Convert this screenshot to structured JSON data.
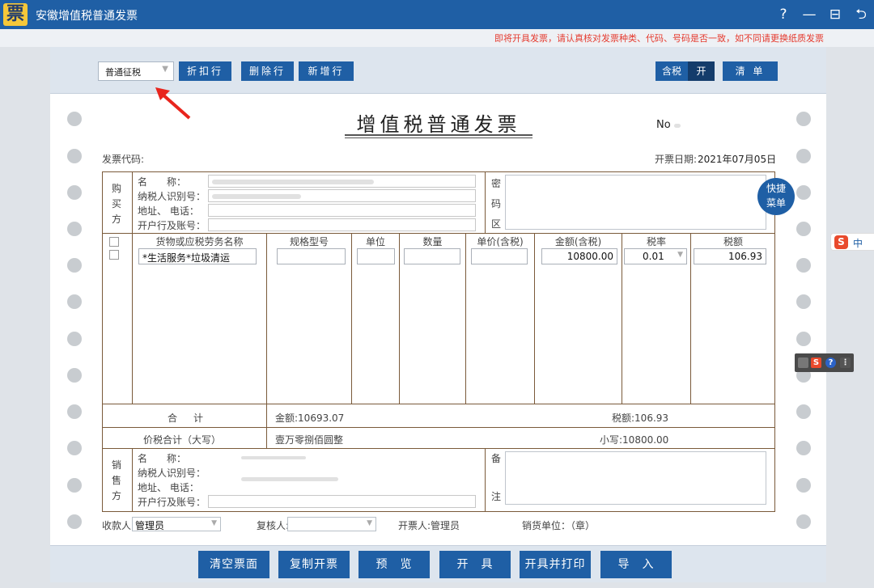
{
  "window": {
    "title": "安徽增值税普通发票",
    "logo_text": "票",
    "controls": [
      "?",
      "—",
      "⊟",
      "⮌"
    ]
  },
  "notice": "即将开具发票，请认真核对发票种类、代码、号码是否一致，如不同请更换纸质发票",
  "toolbar": {
    "tax_mode": "普通征税",
    "discount_btn": "折扣行",
    "delete_btn": "删除行",
    "add_btn": "新增行",
    "tax_incl_label": "含税",
    "tax_incl_state": "开",
    "list_btn": "清 单"
  },
  "invoice": {
    "title": "增值税普通发票",
    "no_label": "No",
    "code_label": "发票代码:",
    "date_label": "开票日期:",
    "date_value": "2021年07月05日",
    "buyer": {
      "side_label": [
        "购",
        "买",
        "方"
      ],
      "name_label": "名　　称：",
      "taxid_label": "纳税人识别号：",
      "addr_label": "地址、 电话：",
      "bank_label": "开户行及账号："
    },
    "cipher_label": [
      "密",
      "码",
      "区"
    ],
    "columns": [
      "货物或应税劳务名称",
      "规格型号",
      "单位",
      "数量",
      "单价(含税)",
      "金额(含税)",
      "税率",
      "税额"
    ],
    "rows": [
      {
        "name": "*生活服务*垃圾清运",
        "spec": "",
        "unit": "",
        "qty": "",
        "price": "",
        "amount": "10800.00",
        "rate": "0.01",
        "tax": "106.93"
      }
    ],
    "total_label": "合　计",
    "total_amount": "金额:10693.07",
    "total_tax": "税额:106.93",
    "grand_label": "价税合计（大写）",
    "grand_upper": "壹万零捌佰圆整",
    "grand_lower": "小写:10800.00",
    "seller": {
      "side_label": [
        "销",
        "售",
        "方"
      ],
      "name_label": "名　　称：",
      "taxid_label": "纳税人识别号：",
      "addr_label": "地址、 电话：",
      "bank_label": "开户行及账号："
    },
    "remark_label": [
      "备",
      "注"
    ],
    "payee_label": "收款人:",
    "payee_value": "管理员",
    "reviewer_label": "复核人:",
    "drawer": "开票人:管理员",
    "seller_seal": "销货单位：（章）"
  },
  "quick_menu": [
    "快捷",
    "菜单"
  ],
  "bottom_buttons": [
    "清空票面",
    "复制开票",
    "预　览",
    "开　具",
    "开具并打印",
    "导　入"
  ],
  "ime": {
    "logo": "S",
    "lang": "中"
  }
}
